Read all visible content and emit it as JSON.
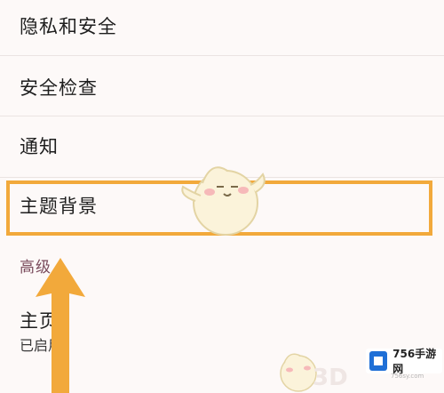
{
  "settings": {
    "items": [
      {
        "label": "隐私和安全"
      },
      {
        "label": "安全检查"
      },
      {
        "label": "通知"
      },
      {
        "label": "主题背景"
      }
    ],
    "section_header": "高级",
    "homepage": {
      "label": "主页",
      "status": "已启用"
    }
  },
  "watermark": {
    "logo_text": "756手游网",
    "logo_sub": "756sy.com",
    "corner_text": "3D"
  },
  "colors": {
    "highlight": "#f2a93b",
    "arrow": "#f2a93b",
    "section_header": "#7a4b5c",
    "background": "#fdf9f8"
  }
}
